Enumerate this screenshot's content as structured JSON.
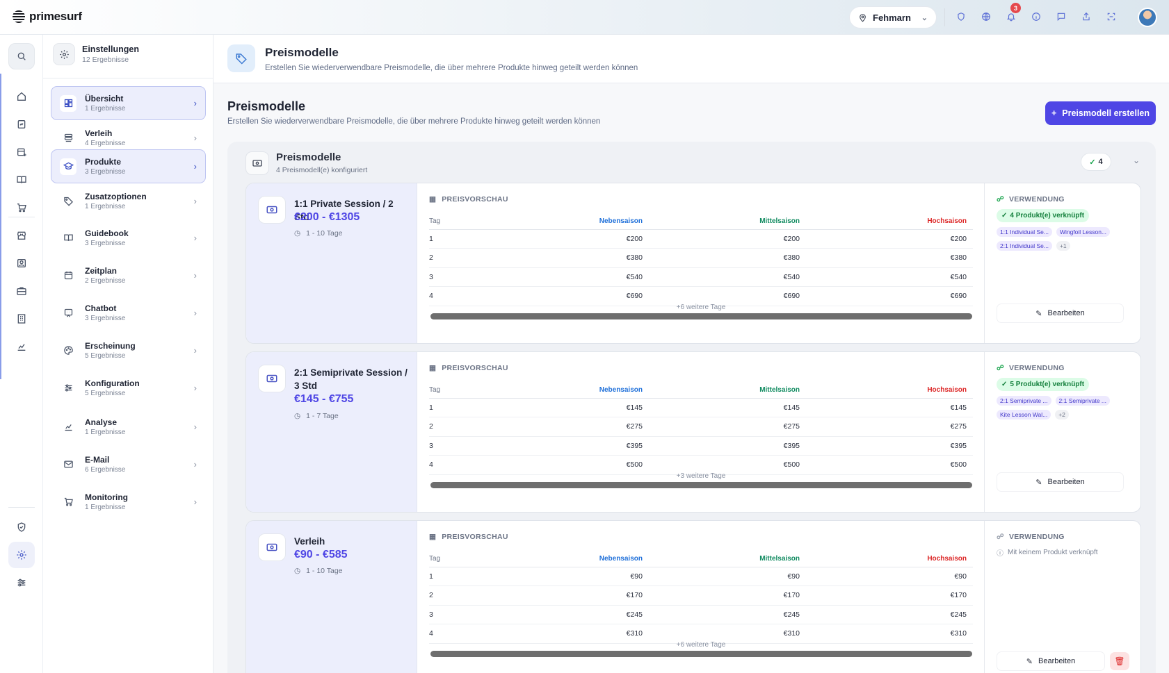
{
  "app": {
    "logo_text": "primesurf"
  },
  "topbar": {
    "location": "Fehmarn",
    "notifications_count": "3",
    "icons": [
      "shield-check-icon",
      "globe-icon",
      "bell-icon",
      "info-icon",
      "chat-icon",
      "share-icon",
      "scan-icon"
    ]
  },
  "rail": {
    "icons": [
      "search-icon",
      "home-icon",
      "invoice-icon",
      "calendar-plus-icon",
      "book-icon",
      "cart-icon",
      "store-icon",
      "contact-card-icon",
      "briefcase-icon",
      "building-icon",
      "chart-icon",
      "shield-check-icon",
      "gear-icon",
      "sliders-icon"
    ]
  },
  "settings": {
    "title": "Einstellungen",
    "subtitle": "12 Ergebnisse",
    "items": [
      {
        "label": "Übersicht",
        "count": "1 Ergebnisse",
        "icon": "dashboard-icon"
      },
      {
        "label": "Verleih",
        "count": "4 Ergebnisse",
        "icon": "stack-icon"
      },
      {
        "label": "Produkte",
        "count": "3 Ergebnisse",
        "icon": "graduation-cap-icon"
      },
      {
        "label": "Zusatzoptionen",
        "count": "1 Ergebnisse",
        "icon": "tag-icon"
      },
      {
        "label": "Guidebook",
        "count": "3 Ergebnisse",
        "icon": "book-icon"
      },
      {
        "label": "Zeitplan",
        "count": "2 Ergebnisse",
        "icon": "calendar-icon"
      },
      {
        "label": "Chatbot",
        "count": "3 Ergebnisse",
        "icon": "chatbot-icon"
      },
      {
        "label": "Erscheinung",
        "count": "5 Ergebnisse",
        "icon": "palette-icon"
      },
      {
        "label": "Konfiguration",
        "count": "5 Ergebnisse",
        "icon": "sliders-icon"
      },
      {
        "label": "Analyse",
        "count": "1 Ergebnisse",
        "icon": "chart-icon"
      },
      {
        "label": "E-Mail",
        "count": "6 Ergebnisse",
        "icon": "mail-icon"
      },
      {
        "label": "Monitoring",
        "count": "1 Ergebnisse",
        "icon": "cart-icon"
      }
    ]
  },
  "page": {
    "title": "Preismodelle",
    "subtitle": "Erstellen Sie wiederverwendbare Preismodelle, die über mehrere Produkte hinweg geteilt werden können"
  },
  "section": {
    "title": "Preismodelle",
    "subtitle": "Erstellen Sie wiederverwendbare Preismodelle, die über mehrere Produkte hinweg geteilt werden können",
    "create_button": "Preismodell erstellen"
  },
  "group": {
    "title": "Preismodelle",
    "subtitle": "4 Preismodell(e) konfiguriert",
    "count": "4"
  },
  "labels": {
    "preview": "PREISVORSCHAU",
    "usage": "VERWENDUNG",
    "col_day": "Tag",
    "col_low": "Nebensaison",
    "col_mid": "Mittelsaison",
    "col_high": "Hochsaison",
    "edit": "Bearbeiten",
    "no_link": "Mit keinem Produkt verknüpft"
  },
  "colors": {
    "accent": "#4f46e5",
    "low_season": "#1e6fd9",
    "mid_season": "#0f8a5f",
    "high_season": "#dc2626"
  },
  "cards": [
    {
      "name": "1:1 Private Session / 2 Std",
      "price": "€200 - €1305",
      "days": "1 - 10 Tage",
      "rows": [
        [
          "1",
          "€200",
          "€200",
          "€200"
        ],
        [
          "2",
          "€380",
          "€380",
          "€380"
        ],
        [
          "3",
          "€540",
          "€540",
          "€540"
        ],
        [
          "4",
          "€690",
          "€690",
          "€690"
        ]
      ],
      "more": "+6 weitere Tage",
      "linked": "4 Produkt(e) verknüpft",
      "chips": [
        "1:1 Individual Se...",
        "Wingfoil Lesson...",
        "2:1 Individual Se...",
        "+1"
      ]
    },
    {
      "name": "2:1 Semiprivate Session / 3 Std",
      "price": "€145 - €755",
      "days": "1 - 7 Tage",
      "rows": [
        [
          "1",
          "€145",
          "€145",
          "€145"
        ],
        [
          "2",
          "€275",
          "€275",
          "€275"
        ],
        [
          "3",
          "€395",
          "€395",
          "€395"
        ],
        [
          "4",
          "€500",
          "€500",
          "€500"
        ]
      ],
      "more": "+3 weitere Tage",
      "linked": "5 Produkt(e) verknüpft",
      "chips": [
        "2:1 Semiprivate ...",
        "2:1 Semiprivate ...",
        "Kite Lesson Wal...",
        "+2"
      ]
    },
    {
      "name": "Verleih",
      "price": "€90 - €585",
      "days": "1 - 10 Tage",
      "rows": [
        [
          "1",
          "€90",
          "€90",
          "€90"
        ],
        [
          "2",
          "€170",
          "€170",
          "€170"
        ],
        [
          "3",
          "€245",
          "€245",
          "€245"
        ],
        [
          "4",
          "€310",
          "€310",
          "€310"
        ]
      ],
      "more": "+6 weitere Tage",
      "linked": "",
      "chips": []
    }
  ]
}
